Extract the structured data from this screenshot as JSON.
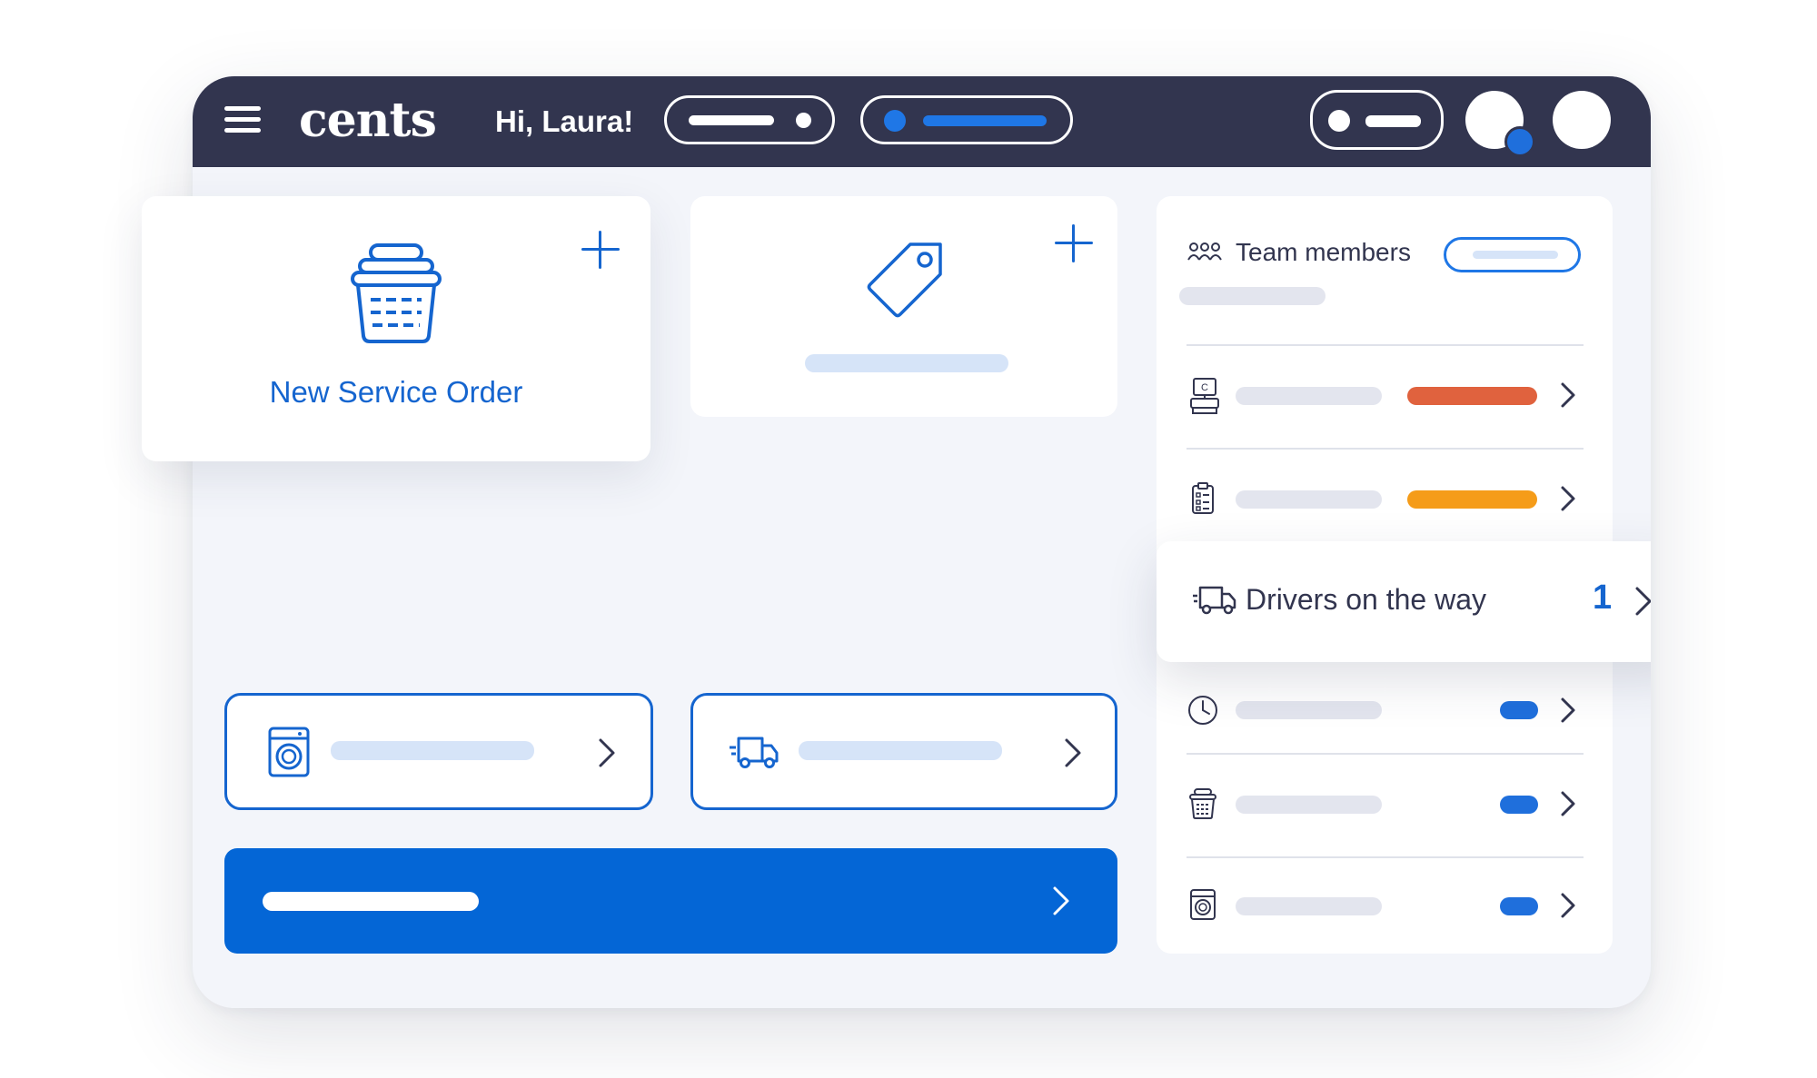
{
  "app": {
    "logo": "cents",
    "greeting": "Hi, Laura!"
  },
  "colors": {
    "navbar": "#32354f",
    "primary": "#0466d6",
    "accent_blue": "#1565cf",
    "status_red": "#e0623e",
    "status_orange": "#f59c19",
    "skeleton_blue": "#d6e4f8",
    "skeleton_gray": "#e3e5ee"
  },
  "icons": {
    "menu": "hamburger-icon",
    "basket": "laundry-basket-icon",
    "tag": "price-tag-icon",
    "team": "team-icon",
    "register": "cash-register-icon",
    "clipboard": "clipboard-icon",
    "truck": "delivery-truck-icon",
    "clock": "clock-icon",
    "washer": "washing-machine-icon"
  },
  "main": {
    "new_order_label": "New Service Order"
  },
  "sidebar": {
    "team_label": "Team members",
    "drivers_label": "Drivers on the way",
    "drivers_count": "1"
  }
}
